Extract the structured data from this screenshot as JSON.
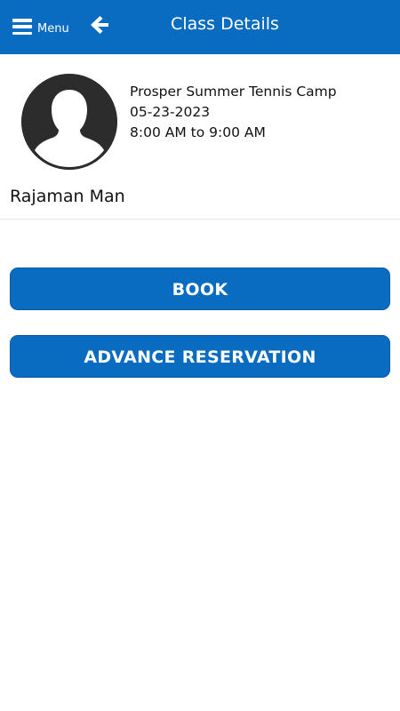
{
  "header": {
    "menu_label": "Menu",
    "menu_icon": "hamburger-icon",
    "back_icon": "arrow-left-icon",
    "title": "Class Details",
    "bg_color": "#0a6cc1"
  },
  "class": {
    "name": "Prosper Summer Tennis Camp",
    "date": "05-23-2023",
    "time": "8:00 AM to 9:00 AM",
    "avatar_icon": "person-silhouette-icon"
  },
  "instructor": {
    "name": "Rajaman Man"
  },
  "actions": {
    "book_label": "BOOK",
    "advance_label": "ADVANCE RESERVATION",
    "accent_color": "#0a6cc1"
  }
}
